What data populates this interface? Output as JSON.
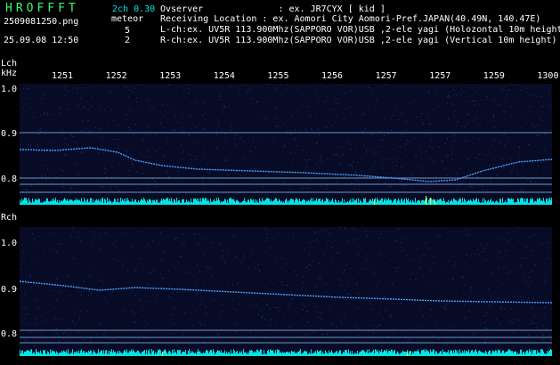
{
  "header": {
    "brand": "HROFFFT",
    "filename": "2509081250.png",
    "datetime": "25.09.08 12:50",
    "version": "2ch 0.30",
    "meteor_label": "meteor",
    "meteor_l": "5",
    "meteor_r": "2",
    "observer": "Ovserver              : ex. JR7CYX [ kid ]",
    "location": "Receiving Location : ex. Aomori City Aomori-Pref.JAPAN(40.49N, 140.47E)",
    "lch_info": "L-ch:ex. UV5R 113.900Mhz(SAPPORO VOR)USB ,2-ele yagi (Holozontal 10m height",
    "rch_info": "R-ch:ex. UV5R 113.900Mhz(SAPPORO VOR)USB ,2-ele yagi (Vertical 10m height)"
  },
  "time_axis": [
    "1251",
    "1252",
    "1253",
    "1254",
    "1255",
    "1256",
    "1257",
    "1257",
    "1259",
    "1300"
  ],
  "lch": {
    "label": "Lch",
    "unit": "kHz",
    "yticks": [
      "1.0",
      "0.9",
      "0.8"
    ]
  },
  "rch": {
    "label": "Rch",
    "yticks": [
      "1.0",
      "0.9",
      "0.8"
    ]
  },
  "colors": {
    "background": "#070b25",
    "trace": "#4aa0ff",
    "baseline": "#00e5e5",
    "meteor": "#ffff40",
    "hline": "#8ec8ff"
  }
}
